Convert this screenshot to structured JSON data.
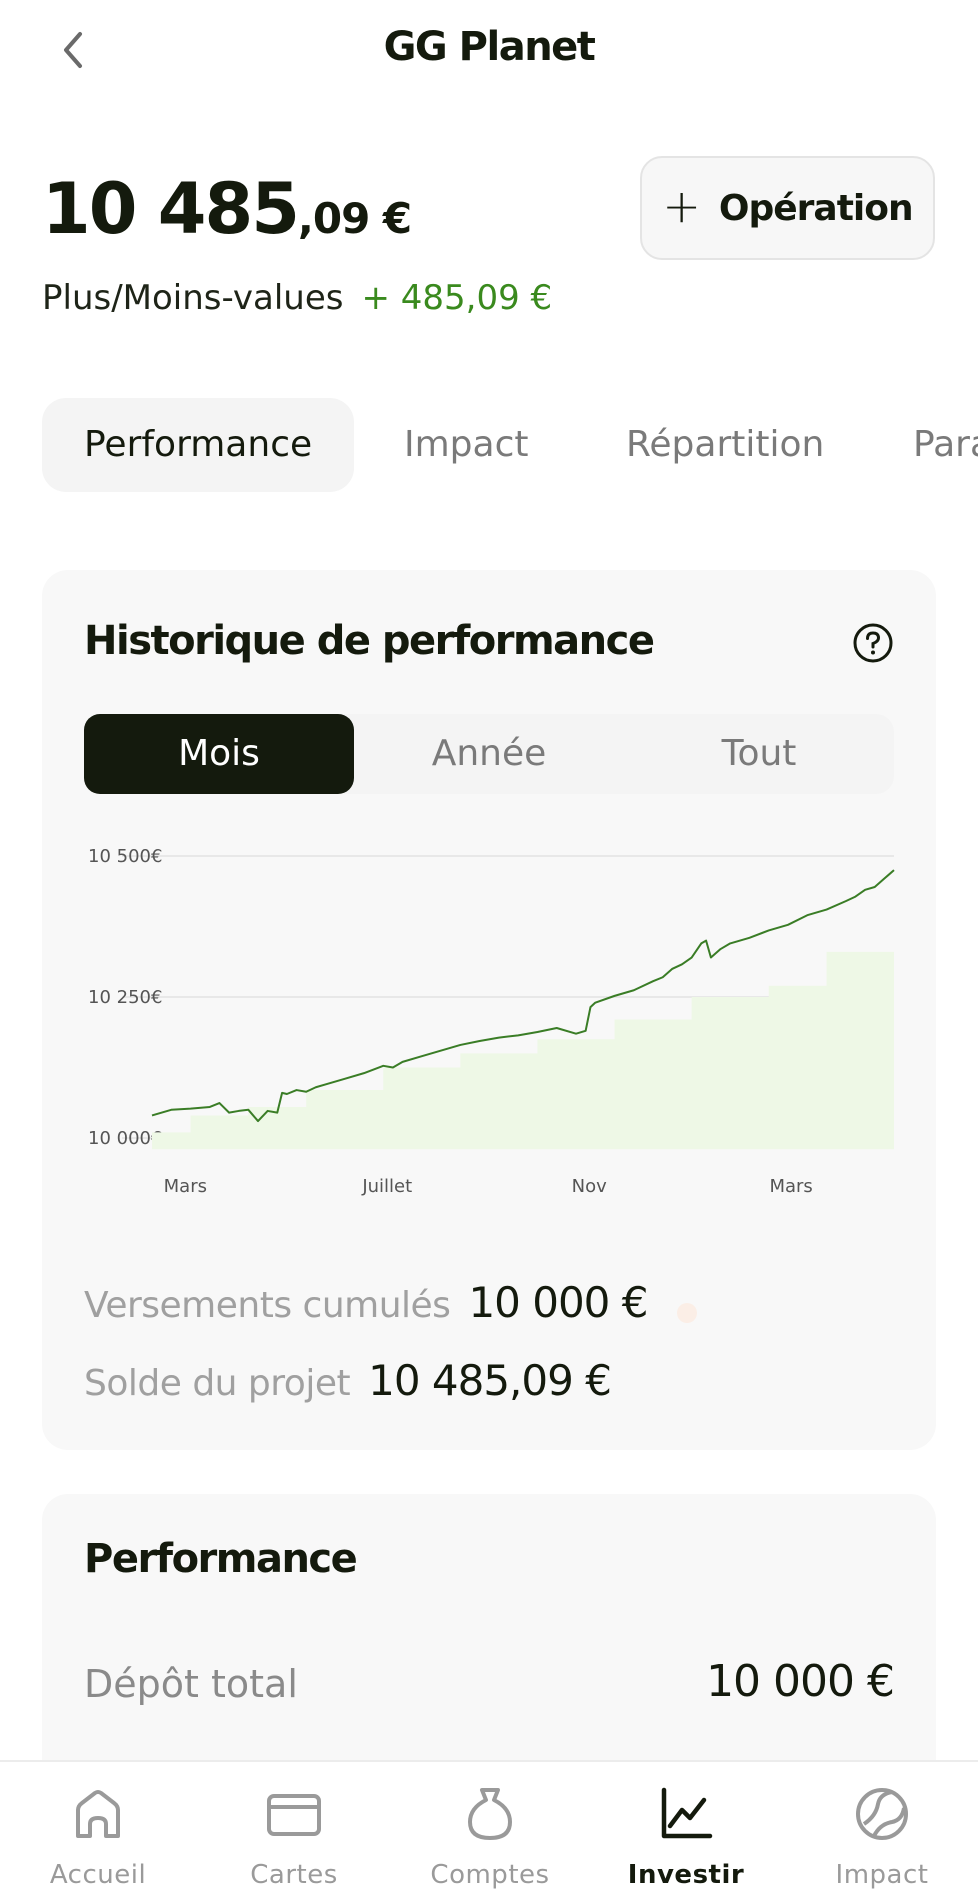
{
  "header": {
    "back_icon": "chevron-left-icon",
    "title": "GG Planet"
  },
  "balance": {
    "integer": "10 485",
    "decimals": ",09 €"
  },
  "gains": {
    "label": "Plus/Moins-values",
    "value": "+ 485,09 €",
    "color": "#3a8a1e"
  },
  "operation_button": {
    "icon": "plus-icon",
    "label": "Opération"
  },
  "tabs": [
    {
      "label": "Performance",
      "active": true
    },
    {
      "label": "Impact",
      "active": false
    },
    {
      "label": "Répartition",
      "active": false
    },
    {
      "label": "Paramètres",
      "active": false
    }
  ],
  "history": {
    "title": "Historique de performance",
    "help_icon": "question-circle-icon",
    "periods": [
      {
        "label": "Mois",
        "active": true
      },
      {
        "label": "Année",
        "active": false
      },
      {
        "label": "Tout",
        "active": false
      }
    ],
    "stats": {
      "deposits_label": "Versements cumulés",
      "deposits_value": "10 000 €",
      "balance_label": "Solde du projet",
      "balance_value": "10 485,09 €"
    }
  },
  "chart_data": {
    "type": "area",
    "title": "",
    "xlabel": "",
    "ylabel": "",
    "ylim": [
      10000,
      10500
    ],
    "y_ticks": [
      10000,
      10250,
      10500
    ],
    "y_tick_labels": [
      "10 000€",
      "10 250€",
      "10 500€"
    ],
    "x_tick_labels": [
      "Mars",
      "Juillet",
      "Nov",
      "Mars"
    ],
    "grid": true,
    "legend": "none",
    "line_color": "#3a7d26",
    "fill_color": "#eef8e6",
    "series": [
      {
        "x": [
          0,
          4,
          8,
          12,
          14,
          16,
          18,
          20,
          22,
          24,
          26,
          27,
          28,
          30,
          32,
          34,
          36,
          40,
          44,
          48,
          50,
          52,
          56,
          60,
          64,
          68,
          72,
          76,
          80,
          84,
          88,
          90,
          91,
          92,
          96,
          100,
          104,
          106,
          108,
          110,
          112,
          114,
          115,
          116,
          118,
          120,
          124,
          128,
          132,
          136,
          140,
          144,
          146,
          148,
          150,
          152,
          154
        ],
        "values": [
          10040,
          10050,
          10052,
          10055,
          10062,
          10045,
          10048,
          10050,
          10030,
          10048,
          10045,
          10080,
          10078,
          10085,
          10082,
          10090,
          10095,
          10105,
          10115,
          10128,
          10125,
          10135,
          10145,
          10155,
          10165,
          10172,
          10178,
          10182,
          10188,
          10195,
          10185,
          10190,
          10232,
          10240,
          10252,
          10262,
          10278,
          10285,
          10300,
          10308,
          10320,
          10345,
          10350,
          10320,
          10335,
          10345,
          10355,
          10368,
          10378,
          10395,
          10405,
          10420,
          10428,
          10440,
          10445,
          10460,
          10475
        ],
        "steps": {
          "x": [
            0,
            8,
            20,
            32,
            48,
            64,
            80,
            96,
            112,
            128,
            140,
            154
          ],
          "values": [
            10010,
            10040,
            10055,
            10085,
            10125,
            10150,
            10175,
            10210,
            10250,
            10270,
            10330,
            10450
          ]
        }
      }
    ]
  },
  "performance": {
    "title": "Performance",
    "rows": [
      {
        "label": "Dépôt total",
        "value": "10 000 €"
      }
    ]
  },
  "bottom_nav": [
    {
      "label": "Accueil",
      "icon": "home-icon",
      "active": false
    },
    {
      "label": "Cartes",
      "icon": "card-icon",
      "active": false
    },
    {
      "label": "Comptes",
      "icon": "money-bag-icon",
      "active": false
    },
    {
      "label": "Investir",
      "icon": "chart-line-icon",
      "active": true
    },
    {
      "label": "Impact",
      "icon": "globe-icon",
      "active": false
    }
  ]
}
